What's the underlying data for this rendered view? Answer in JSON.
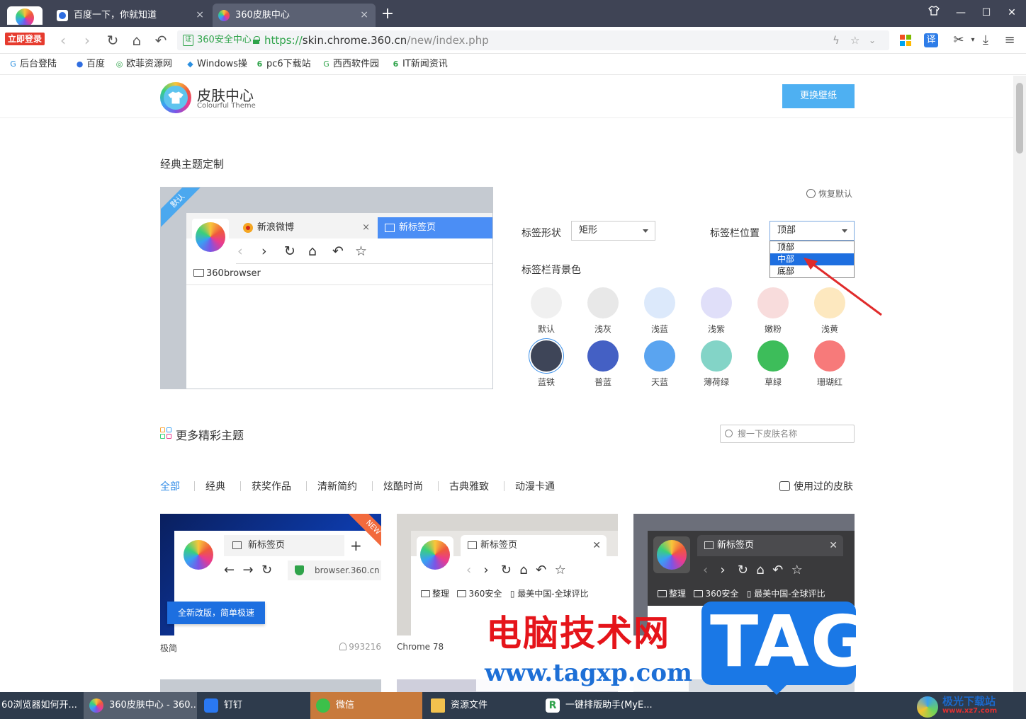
{
  "browser": {
    "login_badge": "立即登录",
    "tabs": [
      {
        "title": "百度一下，你就知道",
        "close": "×"
      },
      {
        "title": "360皮肤中心",
        "close": "×"
      }
    ],
    "new_tab": "+",
    "address": {
      "security_label": "360安全中心",
      "url_scheme": "https://",
      "url_host": "skin.chrome.360.cn",
      "url_path": "/new/index.php"
    },
    "translate_label": "译",
    "bookmarks": [
      "后台登陆",
      "百度",
      "欧菲资源网",
      "Windows操",
      "pc6下载站",
      "西西软件园",
      "IT新闻资讯"
    ]
  },
  "site": {
    "title": "皮肤中心",
    "subtitle": "Colourful Theme",
    "wallpaper_button": "更换壁纸"
  },
  "classic": {
    "title": "经典主题定制",
    "default_badge": "默认",
    "restore_label": "恢复默认",
    "preview": {
      "tab_a": "新浪微博",
      "tab_a_close": "×",
      "tab_b": "新标签页",
      "bookmark": "360browser"
    },
    "shape_label": "标签形状",
    "shape_value": "矩形",
    "position_label": "标签栏位置",
    "position_value": "顶部",
    "position_options": [
      "顶部",
      "中部",
      "底部"
    ],
    "bg_label": "标签栏背景色",
    "colors": [
      {
        "name": "默认",
        "hex": "#f0f0f0"
      },
      {
        "name": "浅灰",
        "hex": "#e8e8e8"
      },
      {
        "name": "浅蓝",
        "hex": "#dce9fb"
      },
      {
        "name": "浅紫",
        "hex": "#e0dff9"
      },
      {
        "name": "嫩粉",
        "hex": "#f8dcdc"
      },
      {
        "name": "浅黄",
        "hex": "#fde8bf"
      },
      {
        "name": "蓝铁",
        "hex": "#3e4558"
      },
      {
        "name": "普蓝",
        "hex": "#4460c4"
      },
      {
        "name": "天蓝",
        "hex": "#5aa4f0"
      },
      {
        "name": "薄荷绿",
        "hex": "#83d4c7"
      },
      {
        "name": "草绿",
        "hex": "#3dbd5a"
      },
      {
        "name": "珊瑚红",
        "hex": "#f77a7a"
      }
    ]
  },
  "more": {
    "title": "更多精彩主题",
    "search_placeholder": "搜一下皮肤名称",
    "categories": [
      "全部",
      "经典",
      "获奖作品",
      "清新简约",
      "炫酷时尚",
      "古典雅致",
      "动漫卡通"
    ],
    "used_label": "使用过的皮肤",
    "cards": [
      {
        "name": "极简",
        "count": "993216",
        "tab": "新标签页",
        "address": "browser.360.cn",
        "banner": "全新改版，简单极速",
        "ribbon": "NEW"
      },
      {
        "name": "Chrome 78",
        "count": "",
        "tab": "新标签页",
        "bookmarks": [
          "整理",
          "360安全",
          "最美中国-全球评比"
        ]
      },
      {
        "name": "",
        "count": "",
        "tab": "新标签页",
        "bookmarks": [
          "整理",
          "360安全",
          "最美中国-全球评比"
        ]
      }
    ]
  },
  "watermark": {
    "text": "电脑技术网",
    "url": "www.tagxp.com",
    "tag": "TAG",
    "xz_name": "极光下载站",
    "xz_site": "www.xz7.com"
  },
  "taskbar": {
    "items": [
      "60浏览器如何开...",
      "360皮肤中心 - 360...",
      "钉钉",
      "微信",
      "资源文件",
      "一键排版助手(MyE..."
    ]
  }
}
